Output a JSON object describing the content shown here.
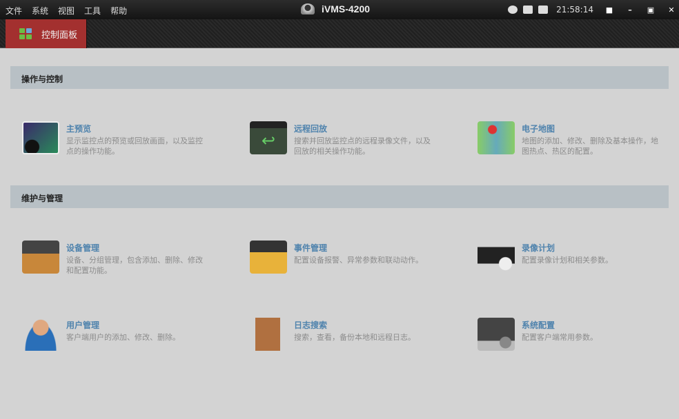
{
  "menu": [
    "文件",
    "系统",
    "视图",
    "工具",
    "帮助"
  ],
  "app_title": "iVMS-4200",
  "tray": {
    "time": "21:58:14",
    "icons": [
      "network-icon",
      "cpu-icon",
      "memory-icon"
    ]
  },
  "window_controls": [
    "lock-icon",
    "minimize-icon",
    "maximize-icon",
    "close-icon"
  ],
  "tab": {
    "label": "控制面板",
    "color": "#a3302f"
  },
  "sections": [
    {
      "title": "操作与控制",
      "items": [
        {
          "title": "主预览",
          "desc": "显示监控点的预览或回放画面，以及监控点的操作功能。",
          "icon": "camera-monitor-icon"
        },
        {
          "title": "远程回放",
          "desc": "搜索并回放监控点的远程录像文件，以及回放的相关操作功能。",
          "icon": "playback-icon"
        },
        {
          "title": "电子地图",
          "desc": "地图的添加、修改、删除及基本操作，地图热点、热区的配置。",
          "icon": "map-icon"
        }
      ]
    },
    {
      "title": "维护与管理",
      "items": [
        {
          "title": "设备管理",
          "desc": "设备、分组管理，包含添加、删除、修改和配置功能。",
          "icon": "device-icon"
        },
        {
          "title": "事件管理",
          "desc": "配置设备报警、异常参数和联动动作。",
          "icon": "event-folder-icon"
        },
        {
          "title": "录像计划",
          "desc": "配置录像计划和相关参数。",
          "icon": "video-camera-clock-icon"
        },
        {
          "title": "用户管理",
          "desc": "客户端用户的添加、修改、删除。",
          "icon": "user-icon"
        },
        {
          "title": "日志搜索",
          "desc": "搜索，查看，备份本地和远程日志。",
          "icon": "log-calendar-icon"
        },
        {
          "title": "系统配置",
          "desc": "配置客户端常用参数。",
          "icon": "system-config-icon"
        }
      ]
    }
  ]
}
